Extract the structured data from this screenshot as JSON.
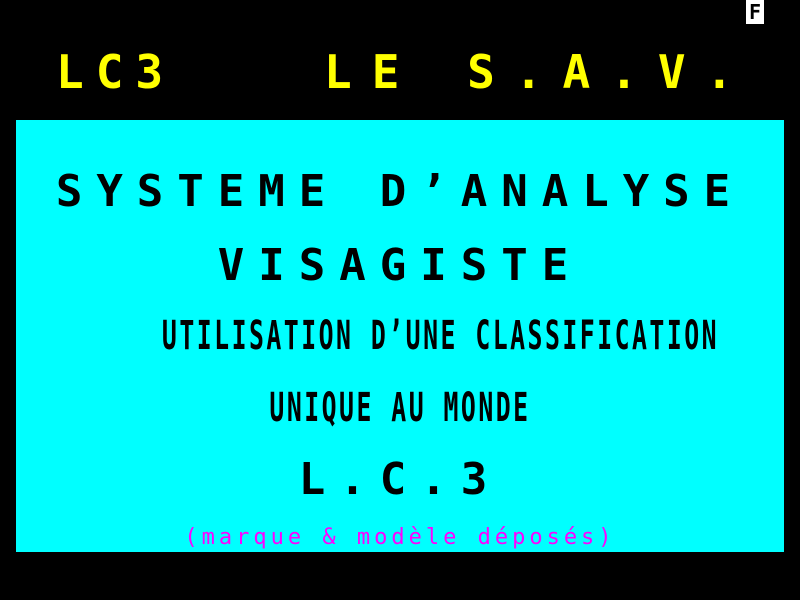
{
  "status": {
    "indicator": "F"
  },
  "header": {
    "code": "LC3",
    "title": "LE S.A.V."
  },
  "content": {
    "line1": "SYSTEME D’ANALYSE",
    "line2": "VISAGISTE",
    "line3": "UTILISATION D’UNE CLASSIFICATION",
    "line4": "UNIQUE AU MONDE",
    "line5": "L.C.3",
    "note": "(marque & modèle déposés)"
  },
  "colors": {
    "background": "#000000",
    "header_text": "#ffff00",
    "panel": "#00ffff",
    "panel_text": "#000000",
    "note_text": "#ff00ff",
    "indicator_bg": "#ffffff"
  }
}
